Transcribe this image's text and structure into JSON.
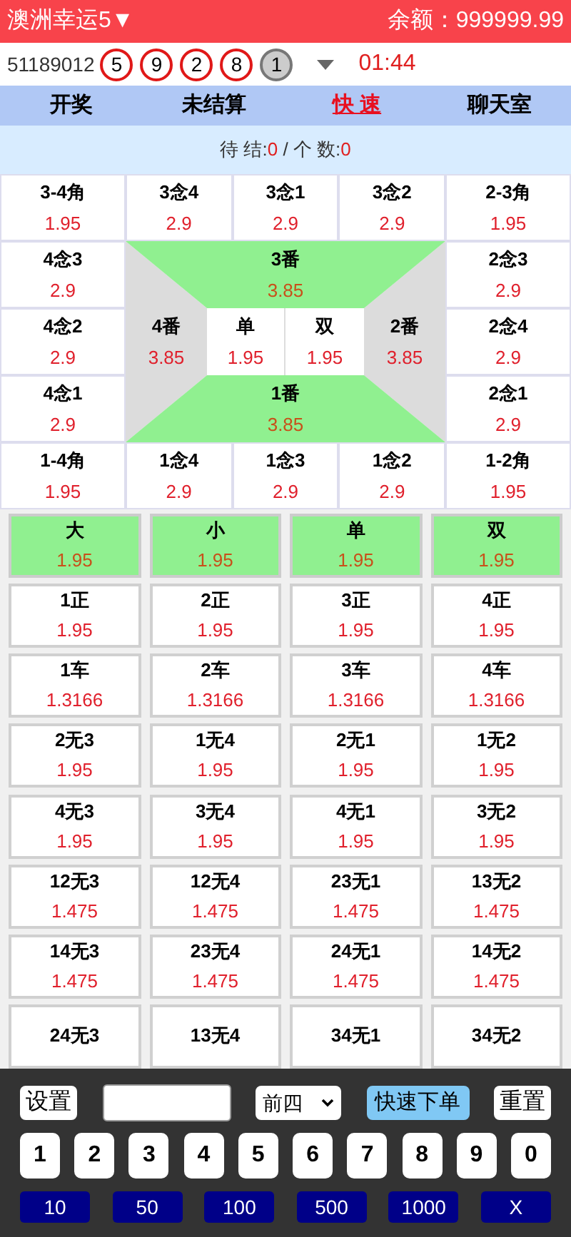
{
  "header": {
    "title": "澳洲幸运5▼",
    "balance": "余额：999999.99"
  },
  "draw": {
    "issue": "51189012",
    "balls": [
      {
        "number": "5",
        "kind": "open"
      },
      {
        "number": "9",
        "kind": "open"
      },
      {
        "number": "2",
        "kind": "open"
      },
      {
        "number": "8",
        "kind": "open"
      },
      {
        "number": "1",
        "kind": "filled"
      }
    ],
    "timer": "01:44"
  },
  "tabs": [
    {
      "label": "开奖",
      "selected": false
    },
    {
      "label": "未结算",
      "selected": false
    },
    {
      "label": "快 速",
      "selected": true
    },
    {
      "label": "聊天室",
      "selected": false
    }
  ],
  "status": {
    "pending_label": "待 结:",
    "pending": "0",
    "count_label": "/ 个 数:",
    "count": "0"
  },
  "board": {
    "top_row": [
      {
        "label": "3-4角",
        "odds": "1.95"
      },
      {
        "label": "3念4",
        "odds": "2.9"
      },
      {
        "label": "3念1",
        "odds": "2.9"
      },
      {
        "label": "3念2",
        "odds": "2.9"
      },
      {
        "label": "2-3角",
        "odds": "1.95"
      }
    ],
    "left_column": [
      {
        "label": "4念3",
        "odds": "2.9"
      },
      {
        "label": "4念2",
        "odds": "2.9"
      },
      {
        "label": "4念1",
        "odds": "2.9"
      }
    ],
    "right_column": [
      {
        "label": "2念3",
        "odds": "2.9"
      },
      {
        "label": "2念4",
        "odds": "2.9"
      },
      {
        "label": "2念1",
        "odds": "2.9"
      }
    ],
    "center": {
      "top": {
        "label": "3番",
        "odds": "3.85"
      },
      "left": {
        "label": "4番",
        "odds": "3.85"
      },
      "middle": [
        {
          "label": "单",
          "odds": "1.95"
        },
        {
          "label": "双",
          "odds": "1.95"
        }
      ],
      "right": {
        "label": "2番",
        "odds": "3.85"
      },
      "bottom": {
        "label": "1番",
        "odds": "3.85"
      }
    },
    "bottom_row": [
      {
        "label": "1-4角",
        "odds": "1.95"
      },
      {
        "label": "1念4",
        "odds": "2.9"
      },
      {
        "label": "1念3",
        "odds": "2.9"
      },
      {
        "label": "1念2",
        "odds": "2.9"
      },
      {
        "label": "1-2角",
        "odds": "1.95"
      }
    ]
  },
  "options": [
    {
      "label": "大",
      "odds": "1.95",
      "highlighted": true
    },
    {
      "label": "小",
      "odds": "1.95",
      "highlighted": true
    },
    {
      "label": "单",
      "odds": "1.95",
      "highlighted": true
    },
    {
      "label": "双",
      "odds": "1.95",
      "highlighted": true
    },
    {
      "label": "1正",
      "odds": "1.95",
      "highlighted": false
    },
    {
      "label": "2正",
      "odds": "1.95",
      "highlighted": false
    },
    {
      "label": "3正",
      "odds": "1.95",
      "highlighted": false
    },
    {
      "label": "4正",
      "odds": "1.95",
      "highlighted": false
    },
    {
      "label": "1车",
      "odds": "1.3166",
      "highlighted": false
    },
    {
      "label": "2车",
      "odds": "1.3166",
      "highlighted": false
    },
    {
      "label": "3车",
      "odds": "1.3166",
      "highlighted": false
    },
    {
      "label": "4车",
      "odds": "1.3166",
      "highlighted": false
    },
    {
      "label": "2无3",
      "odds": "1.95",
      "highlighted": false
    },
    {
      "label": "1无4",
      "odds": "1.95",
      "highlighted": false
    },
    {
      "label": "2无1",
      "odds": "1.95",
      "highlighted": false
    },
    {
      "label": "1无2",
      "odds": "1.95",
      "highlighted": false
    },
    {
      "label": "4无3",
      "odds": "1.95",
      "highlighted": false
    },
    {
      "label": "3无4",
      "odds": "1.95",
      "highlighted": false
    },
    {
      "label": "4无1",
      "odds": "1.95",
      "highlighted": false
    },
    {
      "label": "3无2",
      "odds": "1.95",
      "highlighted": false
    },
    {
      "label": "12无3",
      "odds": "1.475",
      "highlighted": false
    },
    {
      "label": "12无4",
      "odds": "1.475",
      "highlighted": false
    },
    {
      "label": "23无1",
      "odds": "1.475",
      "highlighted": false
    },
    {
      "label": "13无2",
      "odds": "1.475",
      "highlighted": false
    },
    {
      "label": "14无3",
      "odds": "1.475",
      "highlighted": false
    },
    {
      "label": "23无4",
      "odds": "1.475",
      "highlighted": false
    },
    {
      "label": "24无1",
      "odds": "1.475",
      "highlighted": false
    },
    {
      "label": "14无2",
      "odds": "1.475",
      "highlighted": false
    },
    {
      "label": "24无3",
      "highlighted": false
    },
    {
      "label": "13无4",
      "highlighted": false
    },
    {
      "label": "34无1",
      "highlighted": false
    },
    {
      "label": "34无2",
      "highlighted": false
    }
  ],
  "panel": {
    "settings_button": "设置",
    "mode_select": "前四",
    "quick_order_button": "快速下单",
    "reset_button": "重置",
    "keys": [
      "1",
      "2",
      "3",
      "4",
      "5",
      "6",
      "7",
      "8",
      "9",
      "0"
    ],
    "amounts": [
      "10",
      "50",
      "100",
      "500",
      "1000",
      "X"
    ]
  }
}
